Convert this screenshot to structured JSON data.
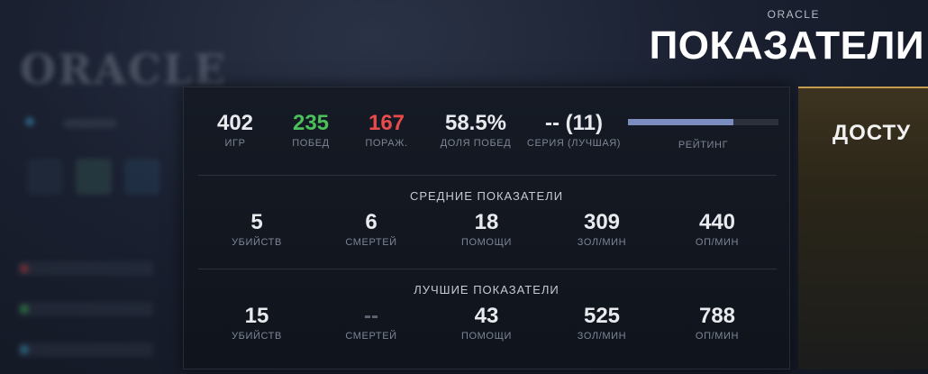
{
  "header": {
    "hero_name_bg": "ORACLE",
    "subtitle": "ORACLE",
    "title": "ПОКАЗАТЕЛИ"
  },
  "summary": {
    "games": {
      "value": "402",
      "label": "ИГР"
    },
    "wins": {
      "value": "235",
      "label": "ПОБЕД"
    },
    "losses": {
      "value": "167",
      "label": "ПОРАЖ."
    },
    "winrate": {
      "value": "58.5%",
      "label": "ДОЛЯ ПОБЕД"
    },
    "streak": {
      "value": "-- (11)",
      "label": "СЕРИЯ (ЛУЧШАЯ)"
    },
    "rating": {
      "label": "РЕЙТИНГ",
      "fill_percent": 70
    }
  },
  "averages": {
    "title": "СРЕДНИЕ ПОКАЗАТЕЛИ",
    "items": [
      {
        "value": "5",
        "label": "УБИЙСТВ"
      },
      {
        "value": "6",
        "label": "СМЕРТЕЙ"
      },
      {
        "value": "18",
        "label": "ПОМОЩИ"
      },
      {
        "value": "309",
        "label": "ЗОЛ/МИН"
      },
      {
        "value": "440",
        "label": "ОП/МИН"
      }
    ]
  },
  "bests": {
    "title": "ЛУЧШИЕ ПОКАЗАТЕЛИ",
    "items": [
      {
        "value": "15",
        "label": "УБИЙСТВ"
      },
      {
        "value": "--",
        "label": "СМЕРТЕЙ"
      },
      {
        "value": "43",
        "label": "ПОМОЩИ"
      },
      {
        "value": "525",
        "label": "ЗОЛ/МИН"
      },
      {
        "value": "788",
        "label": "ОП/МИН"
      }
    ]
  },
  "side_card": {
    "label": "ДОСТУ"
  },
  "colors": {
    "wins": "#4bbf5a",
    "losses": "#e94b4b",
    "rating_bar": "#7b8cbf",
    "side_card_accent": "#c49a4e"
  }
}
